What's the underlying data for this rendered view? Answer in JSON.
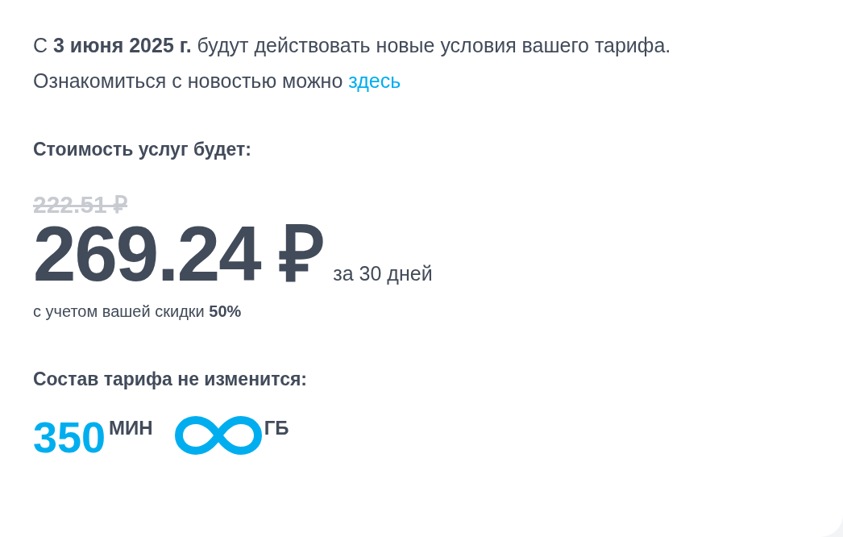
{
  "notice": {
    "text": "С **3 июня 2025 г.** будут действовать новые условия вашего тарифа.",
    "text2": "Ознакомиться с новостью можно",
    "link": "здесь"
  },
  "price": {
    "heading": "Стоимость услуг будет:",
    "old_price": "222.51 ₽",
    "new_price": "269.24 ₽",
    "period": "за 30 дней",
    "discount": "с учетом вашей скидки **50%**"
  },
  "package": {
    "heading": "Состав тарифа не изменится:",
    "items": [
      {
        "kind": "number",
        "value": "350",
        "unit": "МИН"
      },
      {
        "kind": "unlimited",
        "unit": "ГБ"
      }
    ]
  }
}
